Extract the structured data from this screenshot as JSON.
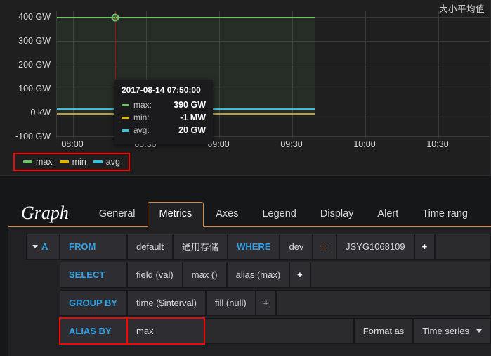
{
  "panel": {
    "title": "大小平均值"
  },
  "chart_data": {
    "type": "line",
    "title": "大小平均值",
    "xlabel": "",
    "ylabel": "",
    "ylim": [
      -100,
      400
    ],
    "yunit": "GW",
    "ytick_labels": [
      "400 GW",
      "300 GW",
      "200 GW",
      "100 GW",
      "0 kW",
      "-100 GW"
    ],
    "ytick_values": [
      400,
      300,
      200,
      100,
      0,
      -100
    ],
    "xtick_labels": [
      "08:00",
      "08:30",
      "09:00",
      "09:30",
      "10:00",
      "10:30"
    ],
    "grid": true,
    "legend_position": "bottom-left",
    "series": [
      {
        "name": "max",
        "color": "#73bf69",
        "value_at_cursor": "390 GW",
        "constant_value": 390
      },
      {
        "name": "min",
        "color": "#e0b400",
        "value_at_cursor": "-1 MW",
        "constant_value": 0
      },
      {
        "name": "avg",
        "color": "#3bc0de",
        "value_at_cursor": "20 GW",
        "constant_value": 20
      }
    ],
    "cursor": {
      "time": "2017-08-14 07:50:00",
      "x_fraction": 0.135
    },
    "data_end_fraction": 0.595
  },
  "tooltip": {
    "time": "2017-08-14 07:50:00",
    "rows": [
      {
        "label": "max:",
        "value": "390 GW",
        "color": "#73bf69"
      },
      {
        "label": "min:",
        "value": "-1 MW",
        "color": "#e0b400"
      },
      {
        "label": "avg:",
        "value": "20 GW",
        "color": "#3bc0de"
      }
    ]
  },
  "legend": {
    "items": [
      {
        "label": "max",
        "color": "#73bf69"
      },
      {
        "label": "min",
        "color": "#e0b400"
      },
      {
        "label": "avg",
        "color": "#3bc0de"
      }
    ]
  },
  "editor": {
    "panel_type": "Graph",
    "tabs": [
      {
        "label": "General",
        "active": false
      },
      {
        "label": "Metrics",
        "active": true
      },
      {
        "label": "Axes",
        "active": false
      },
      {
        "label": "Legend",
        "active": false
      },
      {
        "label": "Display",
        "active": false
      },
      {
        "label": "Alert",
        "active": false
      },
      {
        "label": "Time rang",
        "active": false
      }
    ],
    "query": {
      "ref_id": "A",
      "from_label": "FROM",
      "policy": "default",
      "measurement": "通用存储",
      "where_label": "WHERE",
      "where_key": "dev",
      "where_op": "=",
      "where_value": "JSYG1068109",
      "add": "+",
      "select_label": "SELECT",
      "select_field": "field (val)",
      "select_func": "max ()",
      "select_alias": "alias (max)",
      "groupby_label": "GROUP BY",
      "groupby_time": "time ($interval)",
      "groupby_fill": "fill (null)",
      "alias_label": "ALIAS BY",
      "alias_value": "max",
      "format_label": "Format as",
      "format_value": "Time series"
    }
  },
  "colors": {
    "accent": "#d9883b",
    "keyword": "#33a2e5",
    "highlight": "#ff0000",
    "panel_bg": "#1f1f20",
    "editor_bg": "#212124"
  }
}
